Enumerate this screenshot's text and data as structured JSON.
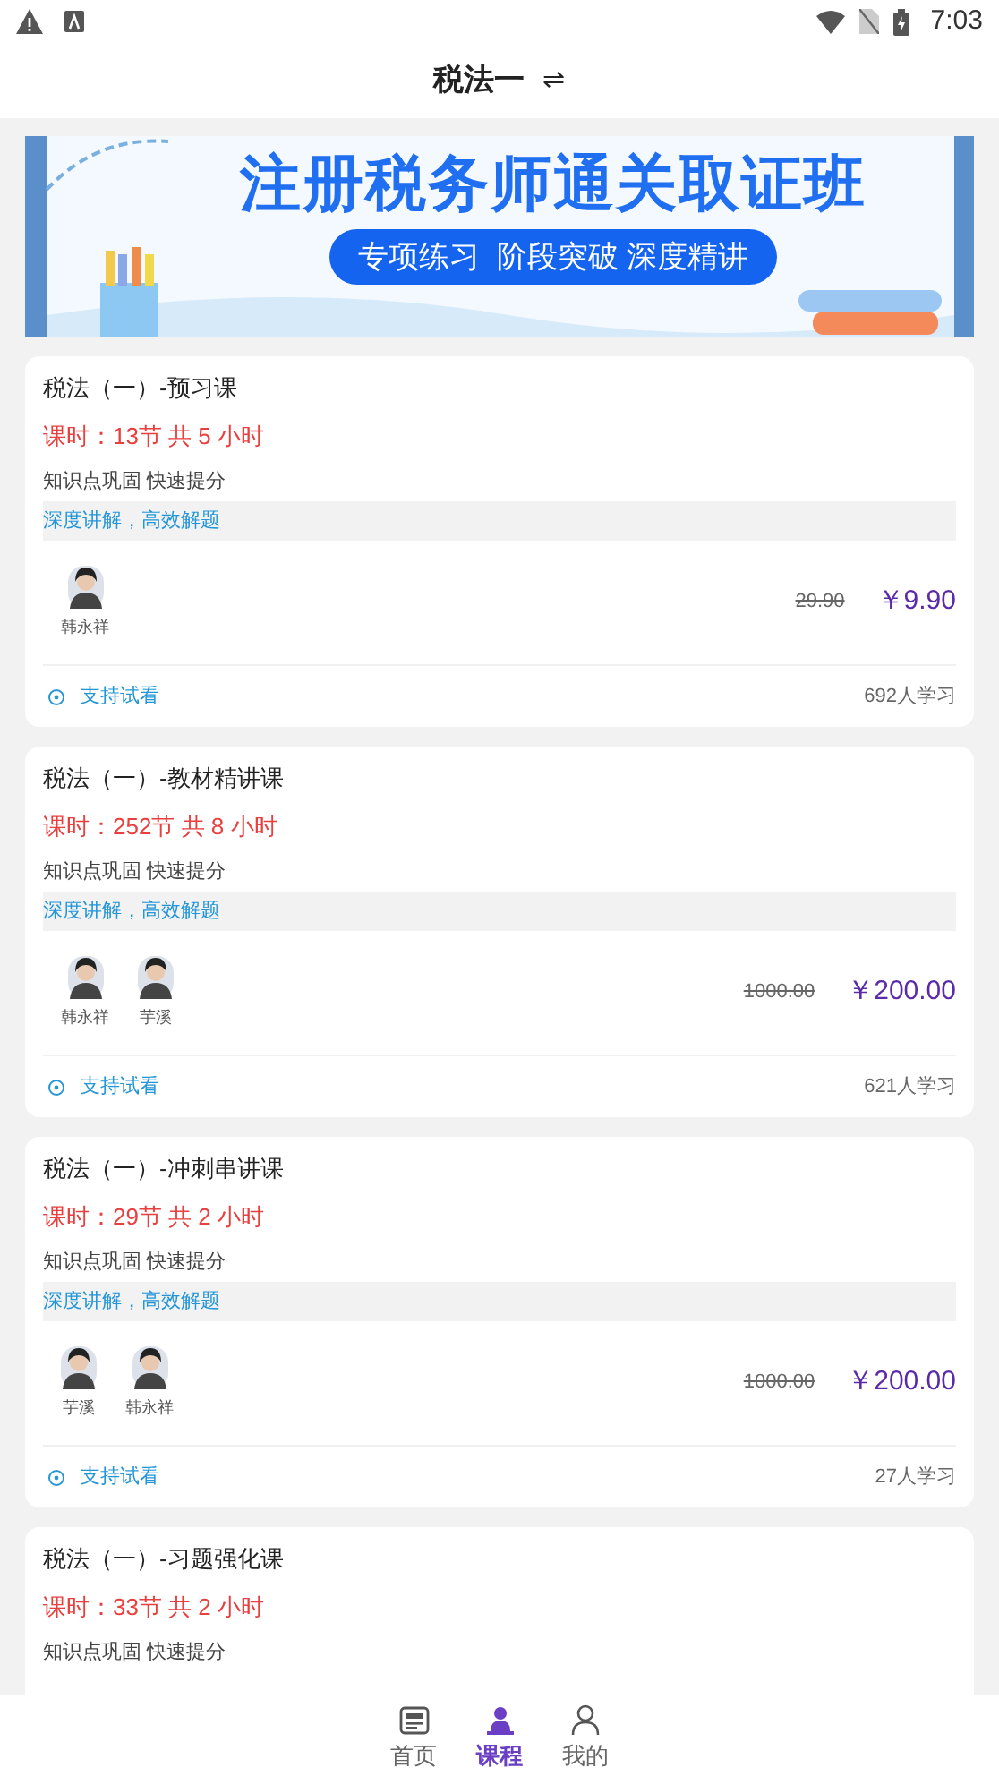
{
  "status_bar": {
    "time": "7:03"
  },
  "header": {
    "title": "税法一",
    "switch_icon": "⇌"
  },
  "banner": {
    "headline": "注册税务师通关取证班",
    "tagline": "专项练习  阶段突破 深度精讲"
  },
  "courses": [
    {
      "title": "税法（一）-预习课",
      "hours": "课时：13节 共 5 小时",
      "desc": "知识点巩固 快速提分",
      "tag": "深度讲解，高效解题",
      "teachers": [
        {
          "name": "韩永祥"
        }
      ],
      "old_price": "29.90",
      "price": "￥9.90",
      "trial": "支持试看",
      "learners": "692人学习"
    },
    {
      "title": "税法（一）-教材精讲课",
      "hours": "课时：252节 共 8 小时",
      "desc": "知识点巩固 快速提分",
      "tag": "深度讲解，高效解题",
      "teachers": [
        {
          "name": "韩永祥"
        },
        {
          "name": "芋溪"
        }
      ],
      "old_price": "1000.00",
      "price": "￥200.00",
      "trial": "支持试看",
      "learners": "621人学习"
    },
    {
      "title": "税法（一）-冲刺串讲课",
      "hours": "课时：29节 共 2 小时",
      "desc": "知识点巩固 快速提分",
      "tag": "深度讲解，高效解题",
      "teachers": [
        {
          "name": "芋溪"
        },
        {
          "name": "韩永祥"
        }
      ],
      "old_price": "1000.00",
      "price": "￥200.00",
      "trial": "支持试看",
      "learners": "27人学习"
    },
    {
      "title": "税法（一）-习题强化课",
      "hours": "课时：33节 共 2 小时",
      "desc": "知识点巩固 快速提分"
    }
  ],
  "bottom_nav": [
    {
      "label": "首页",
      "selected": false
    },
    {
      "label": "课程",
      "selected": true
    },
    {
      "label": "我的",
      "selected": false
    }
  ]
}
